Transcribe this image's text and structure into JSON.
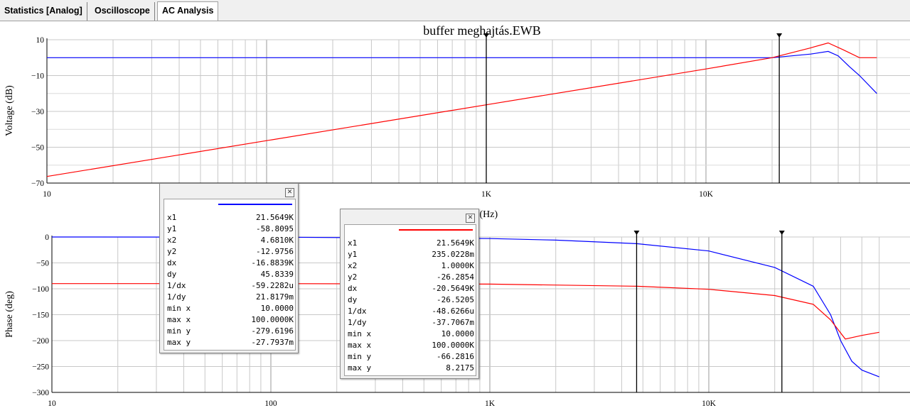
{
  "tabs": [
    {
      "label": "Statistics [Analog]"
    },
    {
      "label": "Oscilloscope"
    },
    {
      "label": "AC Analysis"
    }
  ],
  "colors": {
    "trace1": "#0000ff",
    "trace2": "#ff0000"
  },
  "chart_data": [
    {
      "type": "line",
      "title": "buffer meghajtás.EWB",
      "ylabel": "Voltage (dB)",
      "xscale": "log",
      "xlim": [
        10,
        60000
      ],
      "ylim": [
        -70,
        10
      ],
      "yticks": [
        "10",
        "-10",
        "-30",
        "-50",
        "-70"
      ],
      "xticks": [
        "10",
        "1K",
        "10K"
      ],
      "grid": true,
      "cursors_x": [
        1000,
        21564.9
      ],
      "series": [
        {
          "color": "#0000ff",
          "x": [
            10,
            20000,
            30000,
            36000,
            40000,
            45000,
            50000,
            60000
          ],
          "y": [
            0,
            0,
            2,
            3.5,
            1,
            -5,
            -10,
            -20
          ]
        },
        {
          "color": "#ff0000",
          "x": [
            10,
            100,
            1000,
            10000,
            20000,
            30000,
            36000,
            42000,
            50000,
            60000
          ],
          "y": [
            -66.3,
            -46.3,
            -26.3,
            -6.3,
            0,
            5.5,
            8.2,
            4.5,
            0,
            0
          ]
        }
      ]
    },
    {
      "type": "line",
      "xlabel": "Frequency (Hz)",
      "ylabel": "Phase (deg)",
      "xscale": "log",
      "xlim": [
        10,
        60000
      ],
      "ylim": [
        -300,
        0
      ],
      "yticks": [
        "0",
        "-50",
        "-100",
        "-150",
        "-200",
        "-250",
        "-300"
      ],
      "xticks": [
        "10",
        "100",
        "1K",
        "10K"
      ],
      "grid": true,
      "cursors_x": [
        4681,
        21564.9
      ],
      "series": [
        {
          "color": "#0000ff",
          "x": [
            10,
            100,
            1000,
            2000,
            4681,
            10000,
            20000,
            30000,
            36000,
            40000,
            45000,
            50000,
            60000
          ],
          "y": [
            0,
            -0.3,
            -3,
            -6,
            -12.9,
            -27,
            -58.8,
            -95,
            -150,
            -200,
            -240,
            -257,
            -270
          ]
        },
        {
          "color": "#ff0000",
          "x": [
            10,
            100,
            1000,
            4681,
            10000,
            20000,
            30000,
            36000,
            42000,
            50000,
            60000
          ],
          "y": [
            -90,
            -90,
            -91,
            -95,
            -101,
            -113,
            -130,
            -160,
            -197,
            -190,
            -184
          ]
        }
      ]
    }
  ],
  "popups": [
    {
      "rows": [
        {
          "label": "x1",
          "value": "21.5649K"
        },
        {
          "label": "y1",
          "value": "-58.8095"
        },
        {
          "label": "x2",
          "value": "4.6810K"
        },
        {
          "label": "y2",
          "value": "-12.9756"
        },
        {
          "label": "dx",
          "value": "-16.8839K"
        },
        {
          "label": "dy",
          "value": "45.8339"
        },
        {
          "label": "1/dx",
          "value": "-59.2282u"
        },
        {
          "label": "1/dy",
          "value": "21.8179m"
        },
        {
          "label": "min x",
          "value": "10.0000"
        },
        {
          "label": "max x",
          "value": "100.0000K"
        },
        {
          "label": "min y",
          "value": "-279.6196"
        },
        {
          "label": "max y",
          "value": "-27.7937m"
        }
      ]
    },
    {
      "rows": [
        {
          "label": "x1",
          "value": "21.5649K"
        },
        {
          "label": "y1",
          "value": "235.0228m"
        },
        {
          "label": "x2",
          "value": "1.0000K"
        },
        {
          "label": "y2",
          "value": "-26.2854"
        },
        {
          "label": "dx",
          "value": "-20.5649K"
        },
        {
          "label": "dy",
          "value": "-26.5205"
        },
        {
          "label": "1/dx",
          "value": "-48.6266u"
        },
        {
          "label": "1/dy",
          "value": "-37.7067m"
        },
        {
          "label": "min x",
          "value": "10.0000"
        },
        {
          "label": "max x",
          "value": "100.0000K"
        },
        {
          "label": "min y",
          "value": "-66.2816"
        },
        {
          "label": "max y",
          "value": "8.2175"
        }
      ]
    }
  ]
}
